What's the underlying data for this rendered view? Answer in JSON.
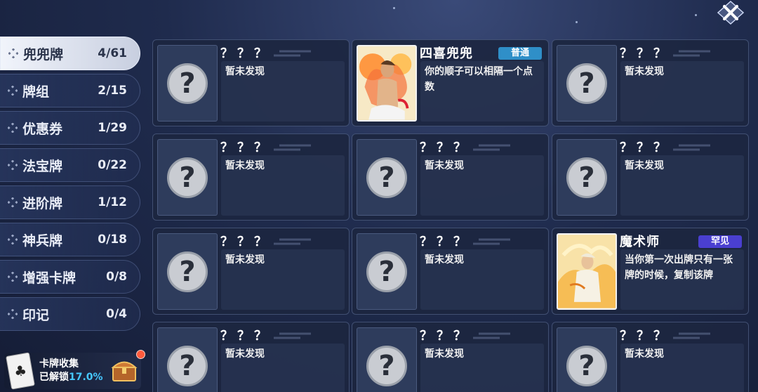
{
  "sidebar": {
    "items": [
      {
        "label": "兜兜牌",
        "count": "4/61",
        "active": true
      },
      {
        "label": "牌组",
        "count": "2/15",
        "active": false
      },
      {
        "label": "优惠券",
        "count": "1/29",
        "active": false
      },
      {
        "label": "法宝牌",
        "count": "0/22",
        "active": false
      },
      {
        "label": "进阶牌",
        "count": "1/12",
        "active": false
      },
      {
        "label": "神兵牌",
        "count": "0/18",
        "active": false
      },
      {
        "label": "增强卡牌",
        "count": "0/8",
        "active": false
      },
      {
        "label": "印记",
        "count": "0/4",
        "active": false
      }
    ]
  },
  "collection": {
    "title": "卡牌收集",
    "unlocked_label": "已解锁",
    "unlocked_pct": "17.0%"
  },
  "cards": [
    {
      "title": "？？？",
      "desc": "暂未发现",
      "locked": true
    },
    {
      "title": "四喜兜兜",
      "desc": "你的顺子可以相隔一个点数",
      "locked": false,
      "rarity": "普通",
      "rarity_color": "#2f8fc8",
      "art": "sun-warrior"
    },
    {
      "title": "？？？",
      "desc": "暂未发现",
      "locked": true
    },
    {
      "title": "？？？",
      "desc": "暂未发现",
      "locked": true
    },
    {
      "title": "？？？",
      "desc": "暂未发现",
      "locked": true
    },
    {
      "title": "？？？",
      "desc": "暂未发现",
      "locked": true
    },
    {
      "title": "？？？",
      "desc": "暂未发现",
      "locked": true
    },
    {
      "title": "？？？",
      "desc": "暂未发现",
      "locked": true
    },
    {
      "title": "魔术师",
      "desc": "当你第一次出牌只有一张牌的时候，复制该牌",
      "locked": false,
      "rarity": "罕见",
      "rarity_color": "#4a3fd0",
      "art": "magician"
    },
    {
      "title": "？？？",
      "desc": "暂未发现",
      "locked": true
    },
    {
      "title": "？？？",
      "desc": "暂未发现",
      "locked": true
    },
    {
      "title": "？？？",
      "desc": "暂未发现",
      "locked": true
    }
  ]
}
